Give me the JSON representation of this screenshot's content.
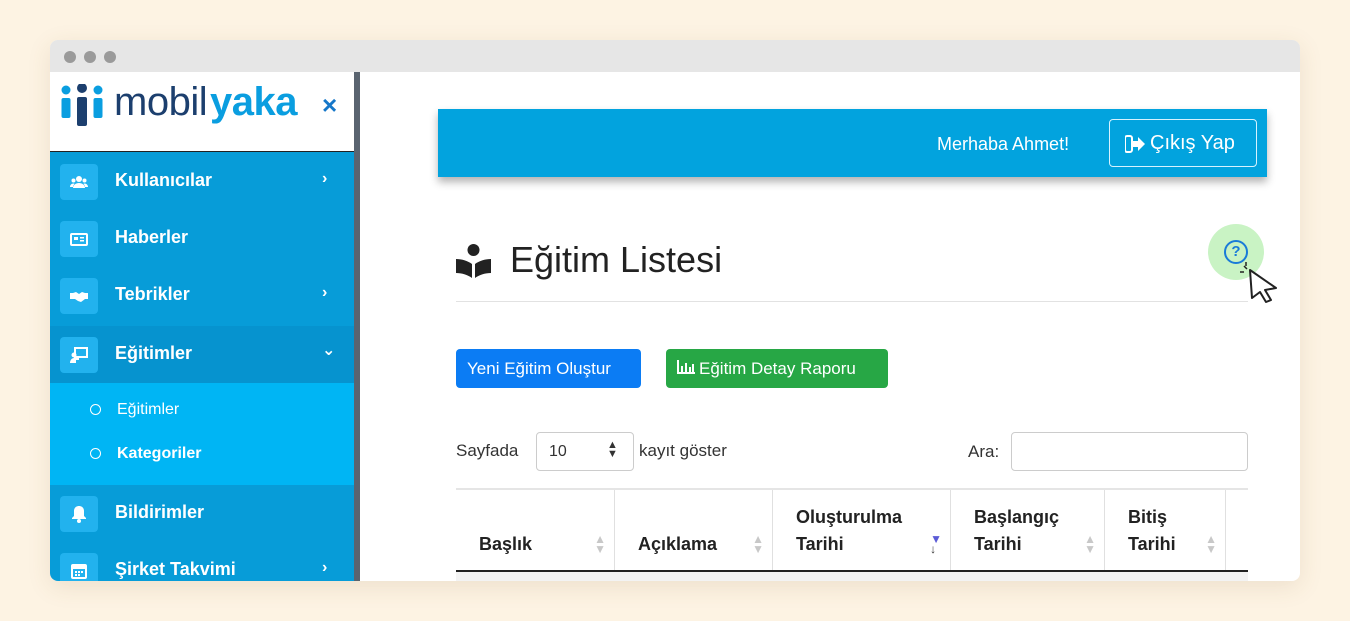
{
  "brand": {
    "mobil": "mobil",
    "yaka": "yaka",
    "close_icon": "×"
  },
  "sidebar": {
    "items": [
      {
        "label": "Kullanıcılar",
        "icon": "users-icon",
        "chevron": "›"
      },
      {
        "label": "Haberler",
        "icon": "newspaper-icon"
      },
      {
        "label": "Tebrikler",
        "icon": "handshake-icon",
        "chevron": "›"
      },
      {
        "label": "Eğitimler",
        "icon": "chalkboard-teacher-icon",
        "chevron": "⌄"
      },
      {
        "label": "Bildirimler",
        "icon": "bell-icon"
      },
      {
        "label": "Şirket Takvimi",
        "icon": "calendar-icon",
        "chevron": "›"
      }
    ],
    "submenu": [
      {
        "label": "Eğitimler"
      },
      {
        "label": "Kategoriler"
      }
    ]
  },
  "topbar": {
    "greeting": "Merhaba Ahmet!",
    "logout_label": "Çıkış Yap",
    "logout_icon": "sign-out-icon"
  },
  "page": {
    "title": "Eğitim Listesi",
    "title_icon": "book-reader-icon",
    "help_icon": "question-circle-icon"
  },
  "actions": {
    "new_label": "Yeni Eğitim Oluştur",
    "report_label": "Eğitim Detay Raporu",
    "report_icon": "chart-bar-icon"
  },
  "table_controls": {
    "length_prefix": "Sayfada",
    "length_value": "10",
    "length_suffix": "kayıt göster",
    "search_label": "Ara:",
    "search_value": ""
  },
  "table": {
    "columns": [
      {
        "line1": "",
        "line2": "Başlık"
      },
      {
        "line1": "",
        "line2": "Açıklama"
      },
      {
        "line1": "Oluşturulma",
        "line2": "Tarihi"
      },
      {
        "line1": "Başlangıç",
        "line2": "Tarihi"
      },
      {
        "line1": "Bitiş",
        "line2": "Tarihi"
      }
    ]
  },
  "colors": {
    "sidebar": "#079cd8",
    "topbar": "#02a3de",
    "primary": "#0b7cf4",
    "success": "#27a745",
    "help_bg": "#c9f3c4"
  }
}
